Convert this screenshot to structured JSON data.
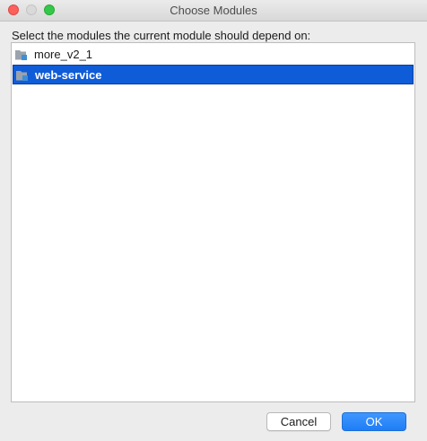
{
  "window": {
    "title": "Choose Modules"
  },
  "dialog": {
    "prompt": "Select the modules the current module should depend on:"
  },
  "modules": [
    {
      "label": "more_v2_1",
      "icon": "module-folder-icon",
      "selected": false
    },
    {
      "label": "web-service",
      "icon": "module-folder-icon",
      "selected": true
    }
  ],
  "buttons": {
    "cancel_label": "Cancel",
    "ok_label": "OK"
  },
  "colors": {
    "selection": "#0f5cd9",
    "ok_button": "#1f7ef5",
    "close": "#fc605c",
    "zoom": "#34c84a"
  }
}
